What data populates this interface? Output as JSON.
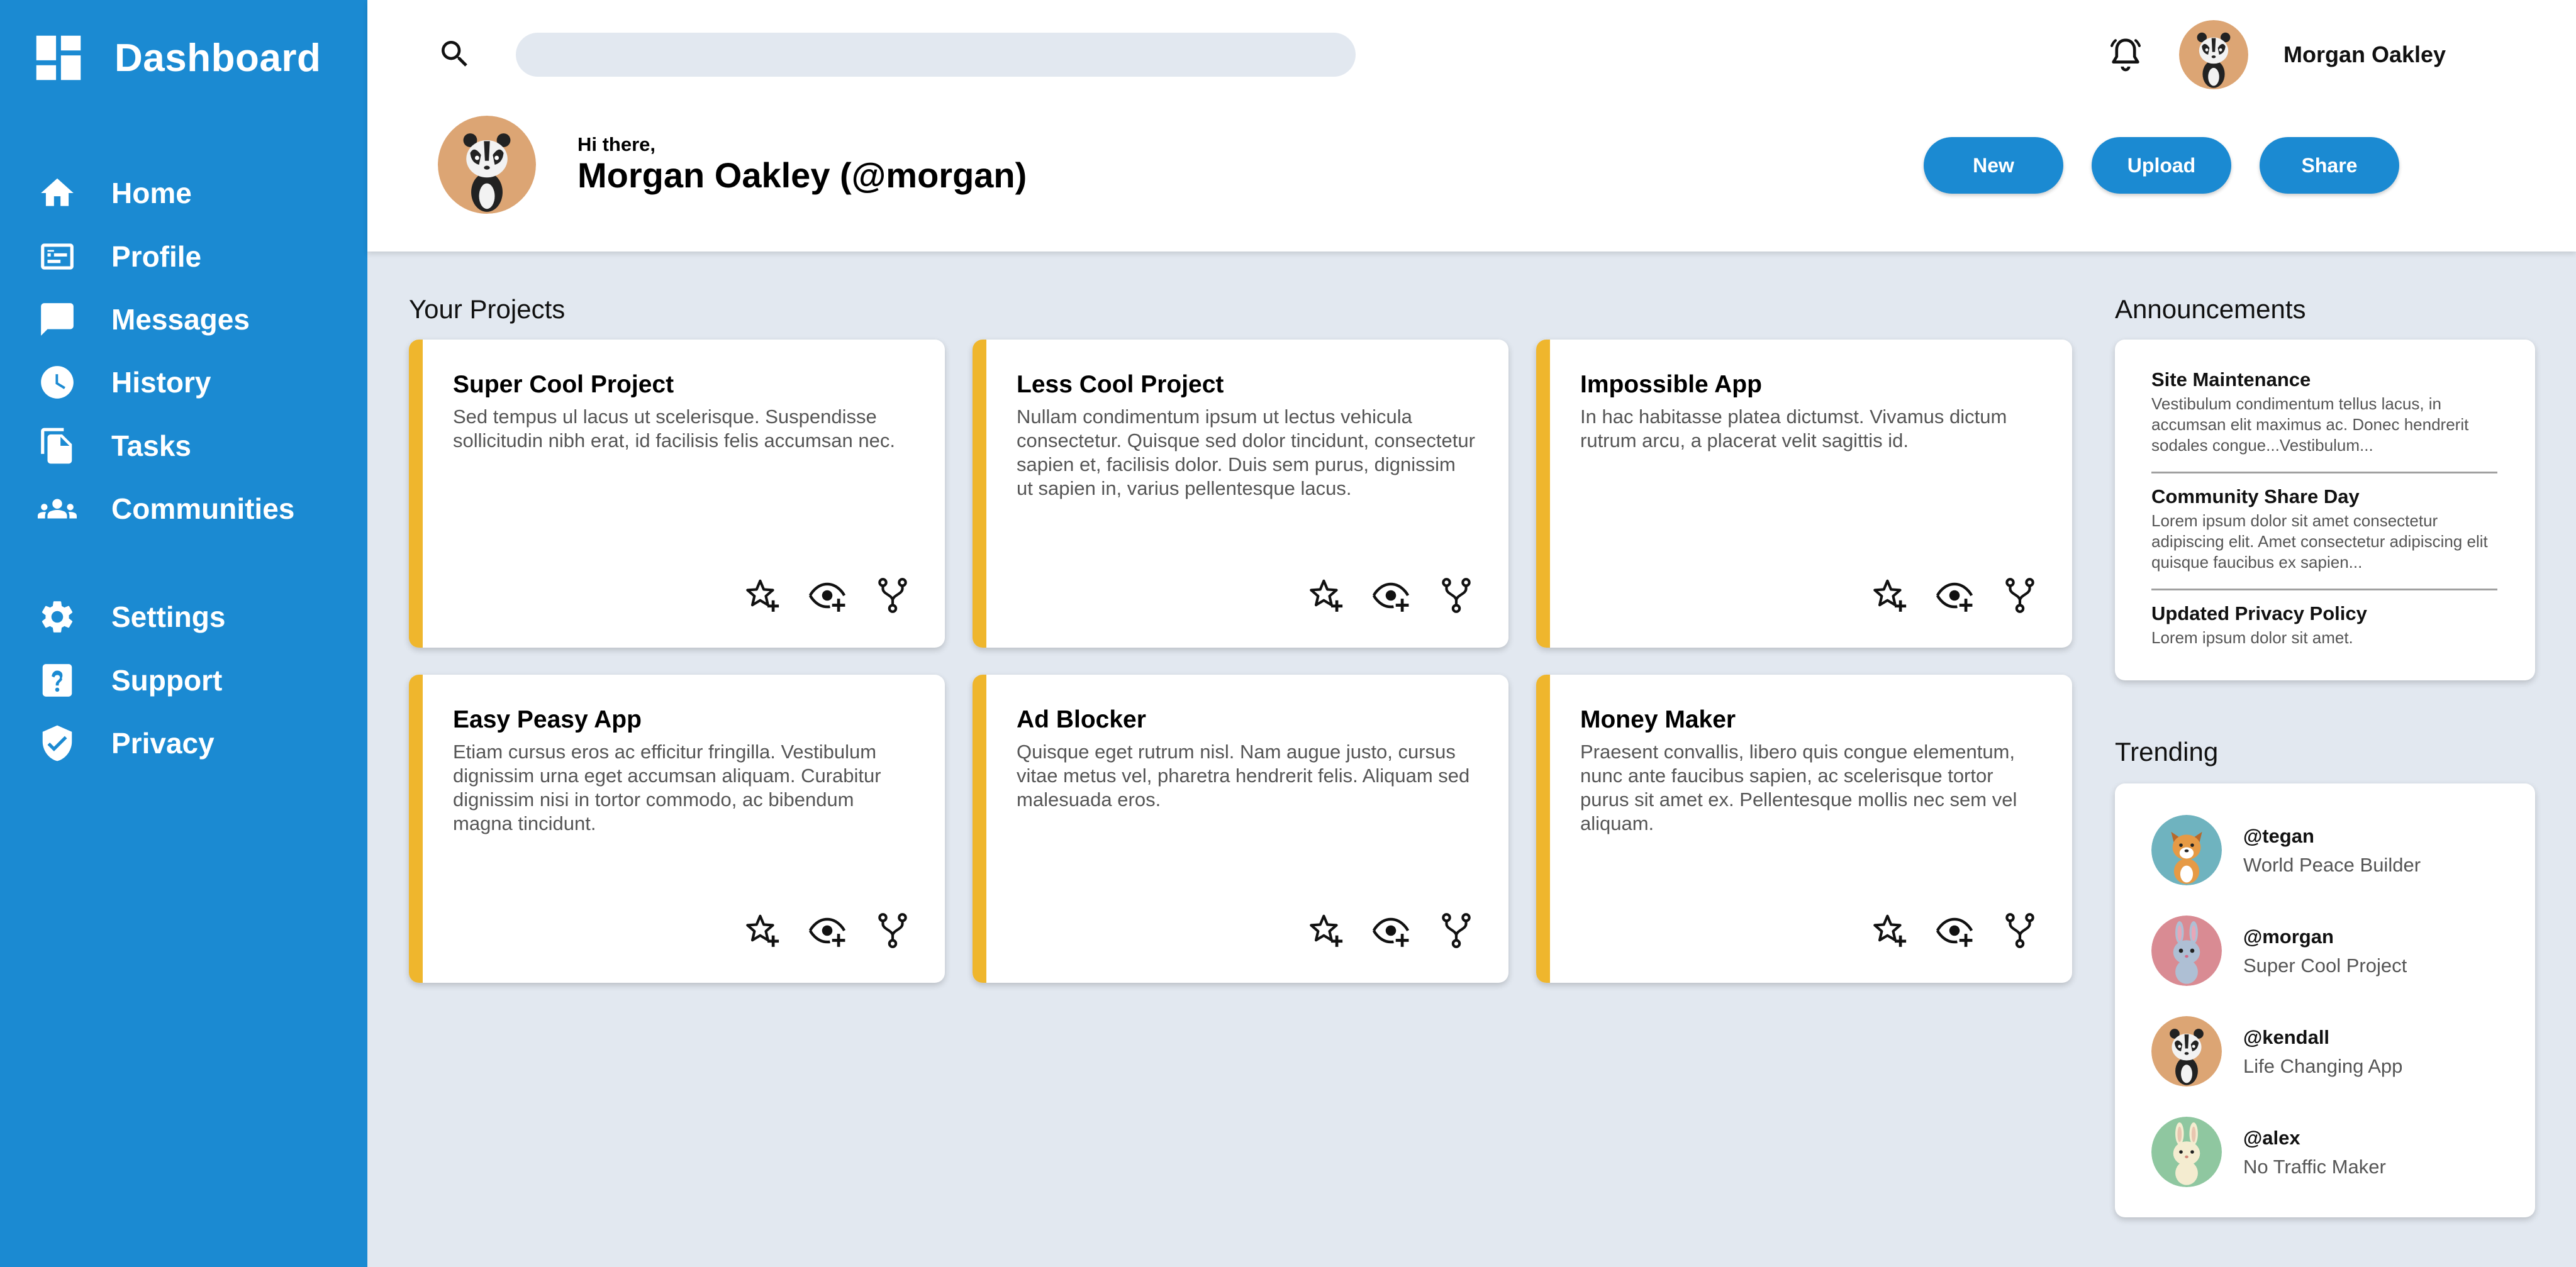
{
  "colors": {
    "sidebar": "#1b8ad2",
    "accent": "#efb62d",
    "background": "#e2e8f0",
    "button": "#1b8ad2"
  },
  "sidebar": {
    "brand": {
      "icon": "dashboard-icon",
      "label": "Dashboard"
    },
    "nav": [
      {
        "icon": "home-icon",
        "label": "Home"
      },
      {
        "icon": "profile-card-icon",
        "label": "Profile"
      },
      {
        "icon": "message-icon",
        "label": "Messages"
      },
      {
        "icon": "clock-icon",
        "label": "History"
      },
      {
        "icon": "document-icon",
        "label": "Tasks"
      },
      {
        "icon": "people-icon",
        "label": "Communities"
      }
    ],
    "secondary": [
      {
        "icon": "gear-icon",
        "label": "Settings"
      },
      {
        "icon": "help-icon",
        "label": "Support"
      },
      {
        "icon": "shield-check-icon",
        "label": "Privacy"
      }
    ]
  },
  "header": {
    "search": {
      "placeholder": "",
      "value": ""
    },
    "user_name": "Morgan Oakley",
    "greeting": "Hi there,",
    "full_name": "Morgan Oakley (@morgan)",
    "buttons": {
      "new": "New",
      "upload": "Upload",
      "share": "Share"
    }
  },
  "projects": {
    "title": "Your Projects",
    "items": [
      {
        "title": "Super Cool Project",
        "description": "Sed tempus ul lacus ut scelerisque. Suspendisse sollicitudin nibh erat, id facilisis felis accumsan nec."
      },
      {
        "title": "Less Cool Project",
        "description": "Nullam condimentum ipsum ut lectus vehicula consectetur. Quisque sed dolor tincidunt, consectetur sapien et, facilisis dolor. Duis sem purus, dignissim ut sapien in, varius pellentesque lacus."
      },
      {
        "title": "Impossible App",
        "description": "In hac habitasse platea dictumst. Vivamus dictum rutrum arcu, a placerat velit sagittis id."
      },
      {
        "title": "Easy Peasy App",
        "description": "Etiam cursus eros ac efficitur fringilla. Vestibulum dignissim urna eget accumsan aliquam. Curabitur dignissim nisi in tortor commodo, ac bibendum magna tincidunt."
      },
      {
        "title": "Ad Blocker",
        "description": "Quisque eget rutrum nisl. Nam augue justo, cursus vitae metus vel, pharetra hendrerit felis. Aliquam sed malesuada eros."
      },
      {
        "title": "Money Maker",
        "description": "Praesent convallis, libero quis congue elementum, nunc ante faucibus sapien, ac scelerisque tortor purus sit amet ex. Pellentesque mollis nec sem vel aliquam."
      }
    ],
    "actions": [
      "star-plus-icon",
      "eye-plus-icon",
      "fork-icon"
    ]
  },
  "announcements": {
    "title": "Announcements",
    "items": [
      {
        "title": "Site Maintenance",
        "body": "Vestibulum condimentum tellus lacus, in accumsan elit maximus ac. Donec hendrerit sodales congue...Vestibulum..."
      },
      {
        "title": "Community Share Day",
        "body": "Lorem ipsum dolor sit amet consectetur adipiscing elit. Amet consectetur adipiscing elit quisque faucibus ex sapien..."
      },
      {
        "title": "Updated Privacy Policy",
        "body": "Lorem ipsum dolor sit amet."
      }
    ]
  },
  "trending": {
    "title": "Trending",
    "items": [
      {
        "handle": "@tegan",
        "project": "World Peace Builder",
        "avatar": "dog-avatar",
        "avatar_bg": "#6fb3bf"
      },
      {
        "handle": "@morgan",
        "project": "Super Cool Project",
        "avatar": "bunny-avatar",
        "avatar_bg": "#d98b93"
      },
      {
        "handle": "@kendall",
        "project": "Life Changing App",
        "avatar": "badger-avatar",
        "avatar_bg": "#dca574"
      },
      {
        "handle": "@alex",
        "project": "No Traffic Maker",
        "avatar": "rabbit-avatar",
        "avatar_bg": "#8fc7a0"
      }
    ]
  }
}
